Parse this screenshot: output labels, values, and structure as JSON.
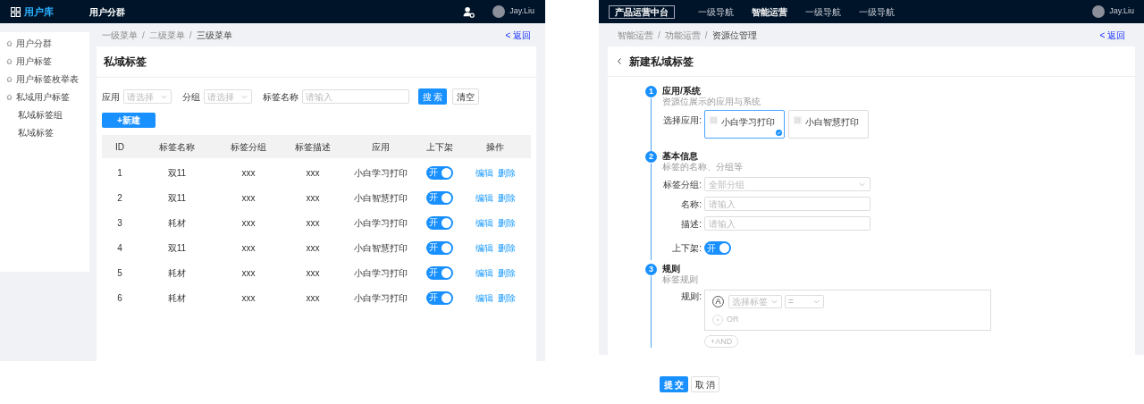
{
  "list_page": {
    "header": {
      "logo": "用户库",
      "nav": [
        {
          "label": "用户分群",
          "selected": true
        }
      ],
      "user": "Jay.Liu"
    },
    "sidebar": {
      "items": [
        {
          "label": "用户分群",
          "selected": false
        },
        {
          "label": "用户标签",
          "selected": false
        },
        {
          "label": "用户标签枚举表",
          "selected": false
        },
        {
          "label": "私域用户标签",
          "selected": false,
          "children": [
            {
              "label": "私域标签组",
              "selected": false
            },
            {
              "label": "私域标签",
              "selected": false
            }
          ]
        }
      ]
    },
    "breadcrumb": [
      "一级菜单",
      "二级菜单",
      "三级菜单"
    ],
    "breadcrumb_separator": "/",
    "back": "< 返回",
    "title": "私域标签",
    "filters": [
      {
        "kind": "select",
        "label": "应用",
        "placeholder": "请选择"
      },
      {
        "kind": "select",
        "label": "分组",
        "placeholder": "请选择"
      },
      {
        "kind": "input",
        "label": "标签名称",
        "placeholder": "请输入"
      }
    ],
    "search_button": "搜 索",
    "clear_button": "清空",
    "new_button": "+新建",
    "table": {
      "columns": [
        "ID",
        "标签名称",
        "标签分组",
        "标签描述",
        "应用",
        "上下架",
        "操作"
      ],
      "rows": [
        {
          "id": "1",
          "name": "双11",
          "group": "xxx",
          "desc": "xxx",
          "app": "小白学习打印",
          "on": true,
          "toggle_text": "开",
          "actions": [
            "编辑",
            "删除"
          ]
        },
        {
          "id": "2",
          "name": "双11",
          "group": "xxx",
          "desc": "xxx",
          "app": "小白智慧打印",
          "on": true,
          "toggle_text": "开",
          "actions": [
            "编辑",
            "删除"
          ]
        },
        {
          "id": "3",
          "name": "耗材",
          "group": "xxx",
          "desc": "xxx",
          "app": "小白学习打印",
          "on": true,
          "toggle_text": "开",
          "actions": [
            "编辑",
            "删除"
          ]
        },
        {
          "id": "4",
          "name": "双11",
          "group": "xxx",
          "desc": "xxx",
          "app": "小白智慧打印",
          "on": true,
          "toggle_text": "开",
          "actions": [
            "编辑",
            "删除"
          ]
        },
        {
          "id": "5",
          "name": "耗材",
          "group": "xxx",
          "desc": "xxx",
          "app": "小白学习打印",
          "on": true,
          "toggle_text": "开",
          "actions": [
            "编辑",
            "删除"
          ]
        },
        {
          "id": "6",
          "name": "耗材",
          "group": "xxx",
          "desc": "xxx",
          "app": "小白学习打印",
          "on": true,
          "toggle_text": "开",
          "actions": [
            "编辑",
            "删除"
          ]
        }
      ]
    }
  },
  "form_page": {
    "header": {
      "brand": "产品运营中台",
      "nav": [
        {
          "label": "一级导航",
          "selected": false
        },
        {
          "label": "智能运营",
          "selected": true
        },
        {
          "label": "一级导航",
          "selected": false
        },
        {
          "label": "一级导航",
          "selected": false
        }
      ],
      "user": "Jay.Liu"
    },
    "breadcrumb": [
      "智能运营",
      "功能运营",
      "资源位管理"
    ],
    "breadcrumb_separator": "/",
    "back": "< 返回",
    "title": "新建私域标签",
    "steps": [
      {
        "number": "1",
        "title": "应用/系统",
        "subtitle": "资源位展示的应用与系统"
      },
      {
        "number": "2",
        "title": "基本信息",
        "subtitle": "标签的名称、分组等"
      },
      {
        "number": "3",
        "title": "规则",
        "subtitle": "标签规则"
      }
    ],
    "app_label": "选择应用:",
    "apps": [
      {
        "name": "小白学习打印",
        "selected": true
      },
      {
        "name": "小白智慧打印",
        "selected": false
      }
    ],
    "fields": [
      {
        "kind": "select",
        "label": "标签分组:",
        "placeholder": "全部分组"
      },
      {
        "kind": "input",
        "label": "名称:",
        "placeholder": "请输入"
      },
      {
        "kind": "input",
        "label": "描述:",
        "placeholder": "请输入"
      },
      {
        "kind": "toggle",
        "label": "上下架:",
        "on": true,
        "text": "开"
      }
    ],
    "rule": {
      "label": "规则:",
      "letter": "A",
      "tag_placeholder": "选择标签",
      "operator": "=",
      "or": "OR",
      "and": "+AND"
    },
    "submit_button": "提 交",
    "cancel_button": "取 消"
  }
}
